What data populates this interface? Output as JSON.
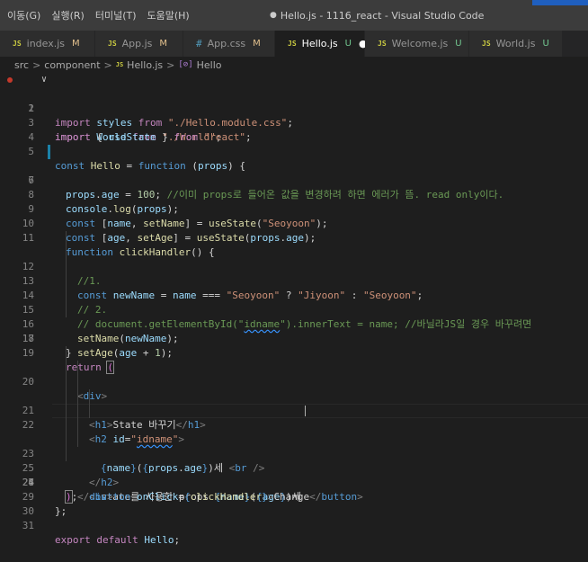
{
  "menu": [
    "이동(G)",
    "실행(R)",
    "터미널(T)",
    "도움말(H)"
  ],
  "window_title": "Hello.js - 1116_react - Visual Studio Code",
  "window_title_dot": "●",
  "tabs": [
    {
      "icon": "JS",
      "name": "index.js",
      "status": "M"
    },
    {
      "icon": "JS",
      "name": "App.js",
      "status": "M"
    },
    {
      "icon": "#",
      "name": "App.css",
      "status": "M"
    },
    {
      "icon": "JS",
      "name": "Hello.js",
      "status": "U",
      "dirty": "●"
    },
    {
      "icon": "JS",
      "name": "Welcome.js",
      "status": "U"
    },
    {
      "icon": "JS",
      "name": "World.js",
      "status": "U"
    }
  ],
  "breadcrumb": {
    "parts": [
      "src",
      "component"
    ],
    "file_icon": "JS",
    "file": "Hello.js",
    "symbol_icon": "[⊘]",
    "symbol": "Hello",
    "separator": ">"
  },
  "editor": {
    "line_numbers": [
      "1",
      "2",
      "3",
      "4",
      "5",
      "6",
      "7",
      "8",
      "9",
      "10",
      "11",
      "12",
      "13",
      "14",
      "15",
      "16",
      "17",
      "18",
      "19",
      "20",
      "21",
      "22",
      "23",
      "24",
      "25",
      "26",
      "27",
      "28",
      "29",
      "30",
      "31"
    ],
    "fold_icon": "∨",
    "tokens": {
      "l1": [
        "import",
        " World ",
        "from",
        " \"./World\"",
        ";"
      ],
      "l2": [
        "import",
        " styles ",
        "from",
        " \"./Hello.module.css\"",
        ";"
      ],
      "l3": [
        "import",
        " { ",
        "useState",
        " } ",
        "from",
        " \"react\"",
        ";"
      ],
      "l5": [
        "const",
        " ",
        "Hello",
        " = ",
        "function",
        " (",
        "props",
        ") {"
      ],
      "l6": [
        "props",
        ".",
        "age",
        " = ",
        "100",
        "; ",
        "//이미 props로 들어온 값을 변경하려 하면 에러가 뜸. read only이다."
      ],
      "l8": [
        "console",
        ".",
        "log",
        "(",
        "props",
        ");"
      ],
      "l9": [
        "const",
        " [",
        "name",
        ", ",
        "setName",
        "] = ",
        "useState",
        "(",
        "\"Seoyoon\"",
        ");"
      ],
      "l10": [
        "const",
        " [",
        "age",
        ", ",
        "setAge",
        "] = ",
        "useState",
        "(",
        "props",
        ".",
        "age",
        ");"
      ],
      "l11": [
        "function",
        " ",
        "clickHandler",
        "() {"
      ],
      "l12": [
        "//1."
      ],
      "l13": [
        "const",
        " ",
        "newName",
        " = ",
        "name",
        " === ",
        "\"Seoyoon\"",
        " ? ",
        "\"Jiyoon\"",
        " : ",
        "\"Seoyoon\"",
        ";"
      ],
      "l14": [
        "// 2."
      ],
      "l15": [
        "// document.getElementById(\"",
        "idname",
        "\").innerText = name; //바닐라JS일 경우 바꾸려면"
      ],
      "l16": [
        "setName",
        "(",
        "newName",
        ");"
      ],
      "l17": [
        "setAge",
        "(",
        "age",
        " + ",
        "1",
        ");"
      ],
      "l18": [
        "}"
      ],
      "l19": [
        "return",
        " ",
        "("
      ],
      "l20": [
        "<",
        "div",
        ">"
      ],
      "l21": [
        "<",
        "h1",
        ">",
        "State 바꾸기",
        "</",
        "h1",
        ">"
      ],
      "l22": [
        "<",
        "h2",
        " ",
        "id",
        "=",
        "\"",
        "idname",
        "\"",
        ">"
      ],
      "l23": [
        "{",
        "name",
        "}",
        "(",
        "{",
        "props",
        ".",
        "age",
        "}",
        ")세 ",
        "<",
        "br",
        " />"
      ],
      "l24": [
        "state를 사용한 props ",
        "{",
        "name",
        "}",
        "(",
        "{",
        "age",
        "}",
        ")세"
      ],
      "l25": [
        "</",
        "h2",
        ">"
      ],
      "l26": [
        "<",
        "button",
        " ",
        "onClick",
        "=",
        "{",
        "clickHandler",
        "}",
        ">",
        "Change",
        "</",
        "button",
        ">"
      ],
      "l27": [
        "</",
        "div",
        ">"
      ],
      "l28": [
        ")",
        ";"
      ],
      "l29": [
        "};"
      ],
      "l31": [
        "export",
        " ",
        "default",
        " ",
        "Hello",
        ";"
      ]
    }
  }
}
